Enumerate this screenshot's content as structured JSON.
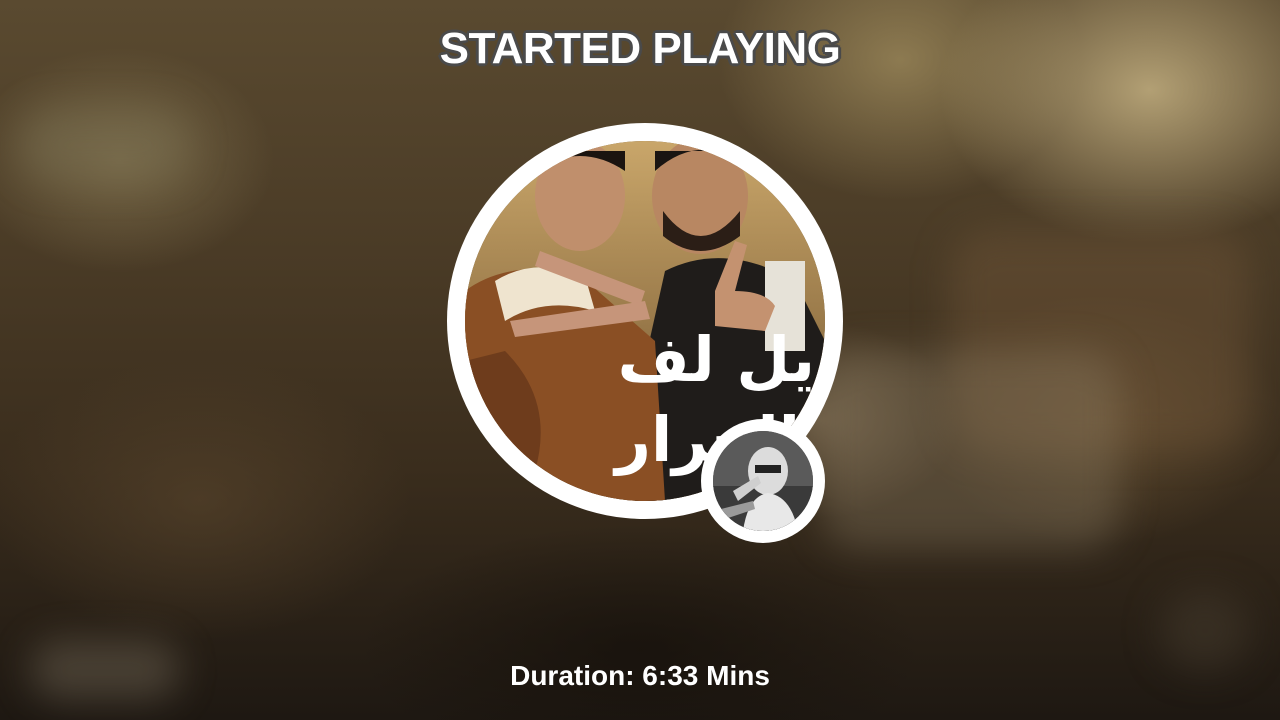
{
  "header": {
    "title": "STARTED PLAYING"
  },
  "artwork": {
    "cover_text": "يل لف الجرار",
    "cover_icon": "album-cover-image",
    "requester_icon": "requester-avatar-image"
  },
  "footer": {
    "duration": "Duration: 6:33 Mins"
  },
  "colors": {
    "ring": "#ffffff",
    "title_text": "#ffffff",
    "title_outline": "#4a4a4a",
    "background_tone": "#3a2d1d"
  }
}
